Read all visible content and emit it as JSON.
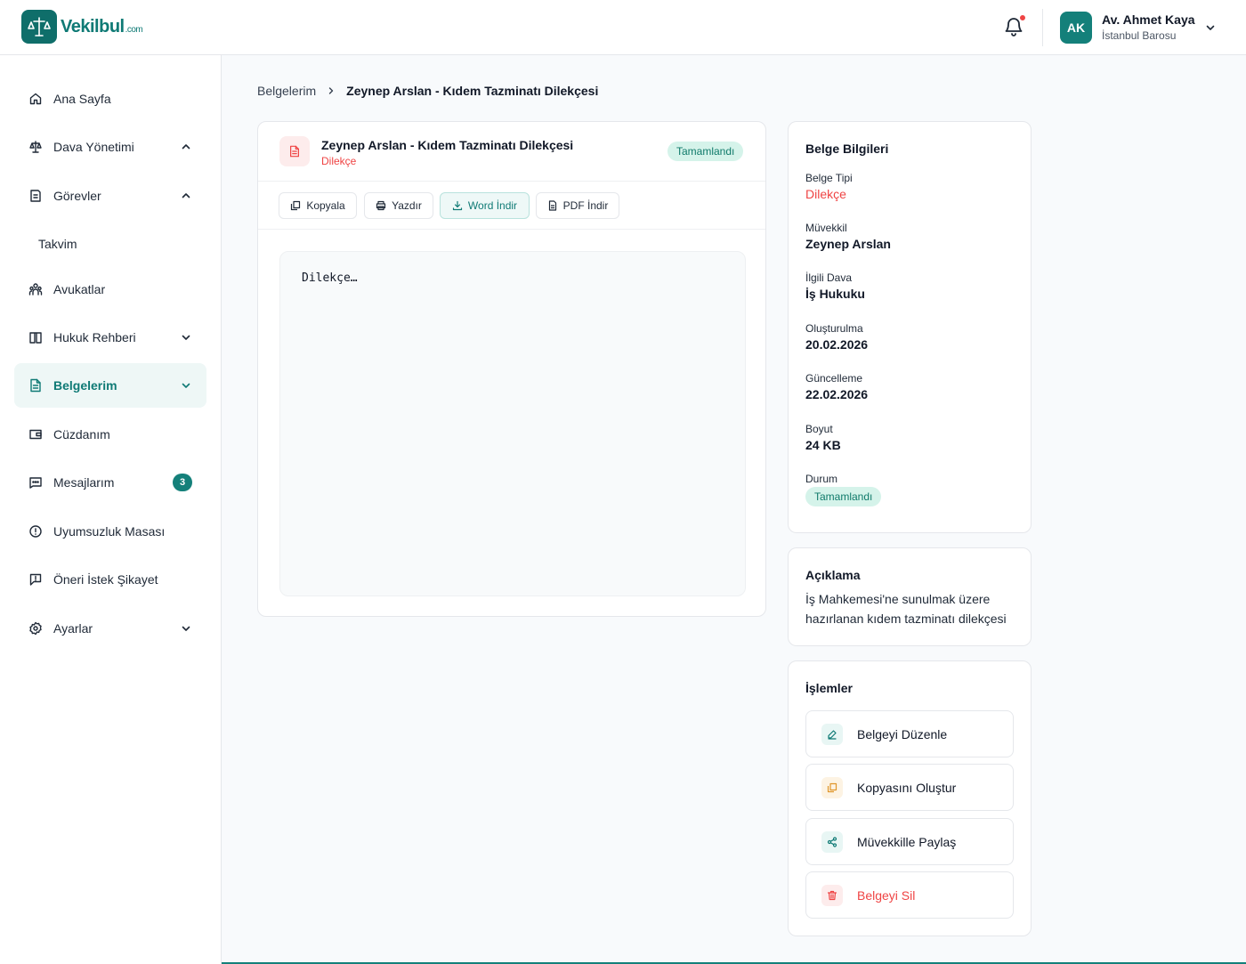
{
  "app": {
    "logo_text": "Vekilbul",
    "logo_suffix": ".com"
  },
  "header": {
    "user": {
      "initials": "AK",
      "name": "Av. Ahmet Kaya",
      "bar": "İstanbul Barosu"
    }
  },
  "sidebar": {
    "items": [
      {
        "label": "Ana Sayfa",
        "icon": "home-icon"
      },
      {
        "label": "Dava Yönetimi",
        "icon": "scale-icon"
      },
      {
        "label": "Görevler",
        "icon": "tasks-icon"
      },
      {
        "label": "Takvim"
      },
      {
        "label": "Avukatlar",
        "icon": "users-icon"
      },
      {
        "label": "Hukuk Rehberi",
        "icon": "book-icon"
      },
      {
        "label": "Belgelerim",
        "icon": "document-icon"
      },
      {
        "label": "Cüzdanım",
        "icon": "wallet-icon"
      },
      {
        "label": "Mesajlarım",
        "icon": "message-icon",
        "badge": "3"
      },
      {
        "label": "Uyumsuzluk Masası",
        "icon": "alert-icon"
      },
      {
        "label": "Öneri İstek Şikayet",
        "icon": "feedback-icon"
      },
      {
        "label": "Ayarlar",
        "icon": "gear-icon"
      }
    ]
  },
  "breadcrumb": {
    "parent": "Belgelerim",
    "current": "Zeynep Arslan - Kıdem Tazminatı Dilekçesi"
  },
  "document": {
    "title": "Zeynep Arslan - Kıdem Tazminatı Dilekçesi",
    "type": "Dilekçe",
    "status": "Tamamlandı",
    "toolbar": {
      "copy": "Kopyala",
      "print": "Yazdır",
      "word": "Word İndir",
      "pdf": "PDF İndir"
    },
    "content": "Dilekçe…"
  },
  "info": {
    "title": "Belge Bilgileri",
    "fields": [
      {
        "label": "Belge Tipi",
        "value": "Dilekçe"
      },
      {
        "label": "Müvekkil",
        "value": "Zeynep Arslan"
      },
      {
        "label": "İlgili Dava",
        "value": "İş Hukuku"
      },
      {
        "label": "Oluşturulma",
        "value": "20.02.2026"
      },
      {
        "label": "Güncelleme",
        "value": "22.02.2026"
      },
      {
        "label": "Boyut",
        "value": "24 KB"
      },
      {
        "label": "Durum",
        "value": "Tamamlandı"
      }
    ]
  },
  "description": {
    "title": "Açıklama",
    "text": "İş Mahkemesi'ne sunulmak üzere hazırlanan kıdem tazminatı dilekçesi"
  },
  "actions": {
    "title": "İşlemler",
    "items": [
      {
        "label": "Belgeyi Düzenle",
        "icon": "edit-icon"
      },
      {
        "label": "Kopyasını Oluştur",
        "icon": "duplicate-icon"
      },
      {
        "label": "Müvekkille Paylaş",
        "icon": "share-icon"
      },
      {
        "label": "Belgeyi Sil",
        "icon": "trash-icon"
      }
    ]
  },
  "colors": {
    "brand": "#14807a",
    "danger": "#ef4444",
    "success_bg": "#d5f3ea"
  }
}
